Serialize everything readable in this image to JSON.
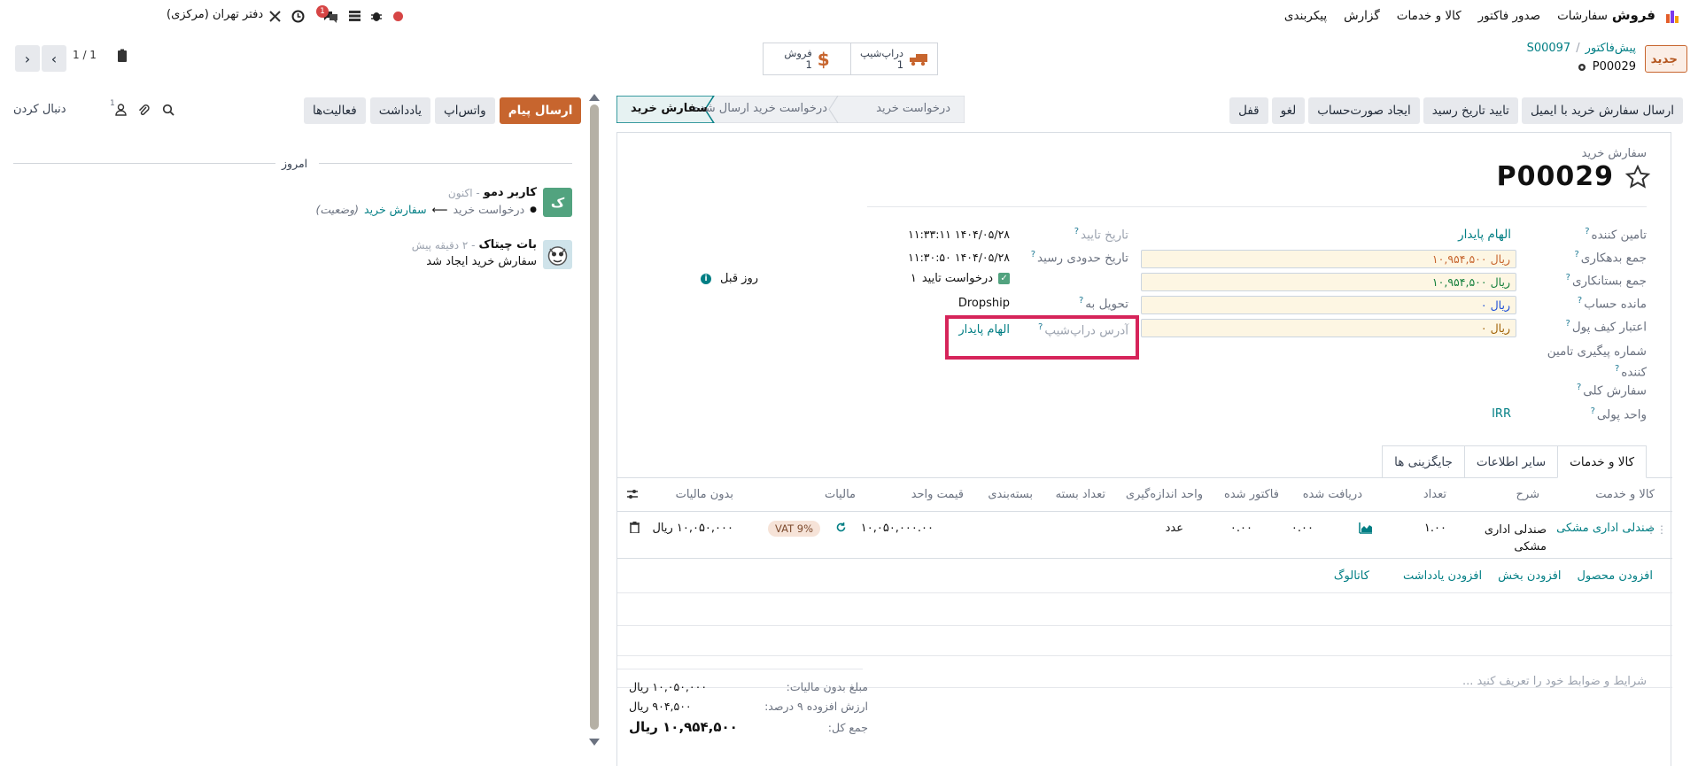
{
  "topbar": {
    "app_name": "فروش",
    "menu": [
      "سفارشات",
      "صدور فاکتور",
      "کالا و خدمات",
      "گزارش",
      "پیکربندی"
    ],
    "company": "دفتر تهران (مرکزی)",
    "chat_badge": "1"
  },
  "control": {
    "new_button": "جدید",
    "breadcrumb_parent": "پیش‌فاکتور",
    "breadcrumb_sep": "/",
    "breadcrumb_current": "S00097",
    "record_name": "P00029",
    "dropship_label": "دراپ‌شیپ",
    "dropship_count": "1",
    "sale_label": "فروش",
    "sale_count": "1",
    "pager": "1 / 1"
  },
  "actions": {
    "send_email": "ارسال سفارش خرید با ایمیل",
    "confirm_receipt": "تایید تاریخ رسید",
    "create_bill": "ایجاد صورت‌حساب",
    "cancel": "لغو",
    "lock": "قفل"
  },
  "status": {
    "stage1": "درخواست خرید",
    "stage2": "درخواست خرید ارسال شده",
    "stage3": "سفارش خرید"
  },
  "chatter": {
    "send_message": "ارسال پیام",
    "whatsapp": "واتس‌اپ",
    "note": "یادداشت",
    "activities": "فعالیت‌ها",
    "follow": "دنبال کردن",
    "followers_count": "1",
    "today": "امروز",
    "msg1_avatar": "ک",
    "msg1_author": "کاربر دمو",
    "msg1_time": "- اکنون",
    "msg1_old": "درخواست خرید",
    "msg1_arrow": "⟵",
    "msg1_new": "سفارش خرید",
    "msg1_field": "(وضعیت)",
    "msg2_author": "بات چیتاک",
    "msg2_time": "- ۲ دقیقه پیش",
    "msg2_body": "سفارش خرید ایجاد شد"
  },
  "form": {
    "doc_type": "سفارش خرید",
    "doc_number": "P00029",
    "vendor_label": "تامین کننده",
    "vendor_value": "الهام پایدار",
    "debit_label": "جمع بدهکاری",
    "debit_value": "۱۰,۹۵۴,۵۰۰",
    "credit_label": "جمع بستانکاری",
    "credit_value": "۱۰,۹۵۴,۵۰۰",
    "balance_label": "مانده حساب",
    "balance_value": "۰",
    "wallet_label": "اعتبار کیف پول",
    "wallet_value": "۰",
    "currency_unit": "ریال",
    "vendor_ref_label": "شماره پیگیری تامین کننده",
    "blanket_label": "سفارش کلی",
    "currency_label": "واحد پولی",
    "currency_value": "IRR",
    "confirm_date_label": "تاریخ تایید",
    "confirm_date_value": "۱۴۰۴/۰۵/۲۸ ۱۱:۳۳:۱۱",
    "expected_date_label": "تاریخ حدودی رسید",
    "expected_date_value": "۱۴۰۴/۰۵/۲۸ ۱۱:۳۰:۵۰",
    "confirm_request": "درخواست تایید",
    "days_before_num": "۱",
    "days_before": "روز قبل",
    "deliver_to_label": "تحویل به",
    "deliver_to_value": "Dropship",
    "dropship_addr_label": "آدرس دراپ‌شیپ",
    "dropship_addr_value": "الهام پایدار"
  },
  "tabs": [
    "کالا و خدمات",
    "سایر اطلاعات",
    "جایگزینی ها"
  ],
  "table": {
    "headers": [
      "کالا و خدمت",
      "شرح",
      "تعداد",
      "دریافت شده",
      "فاکتور شده",
      "واحد اندازه‌گیری",
      "تعداد بسته",
      "بسته‌بندی",
      "قیمت واحد",
      "مالیات",
      "بدون مالیات"
    ],
    "row": {
      "product": "صندلی اداری مشکی",
      "desc": "صندلی اداری مشکی",
      "qty": "۱.۰۰",
      "received": "۰.۰۰",
      "invoiced": "۰.۰۰",
      "uom": "عدد",
      "unit_price": "۱۰,۰۵۰,۰۰۰.۰۰",
      "tax": "VAT 9%",
      "subtotal": "۱۰,۰۵۰,۰۰۰ ریال"
    },
    "add_product": "افزودن محصول",
    "add_section": "افزودن بخش",
    "add_note": "افزودن یادداشت",
    "catalog": "کاتالوگ"
  },
  "footer": {
    "terms_placeholder": "شرایط و ضوابط خود را تعریف کنید ...",
    "untaxed_label": "مبلغ بدون مالیات:",
    "untaxed_value": "۱۰,۰۵۰,۰۰۰ ریال",
    "vat_label": "ارزش افزوده ۹ درصد:",
    "vat_value": "۹۰۴,۵۰۰ ریال",
    "total_label": "جمع کل:",
    "total_value": "۱۰,۹۵۴,۵۰۰ ریال"
  },
  "colors": {
    "accent": "#c7652e",
    "teal": "#017e84",
    "highlight": "#d6245a",
    "avatar": "#52a37f"
  }
}
